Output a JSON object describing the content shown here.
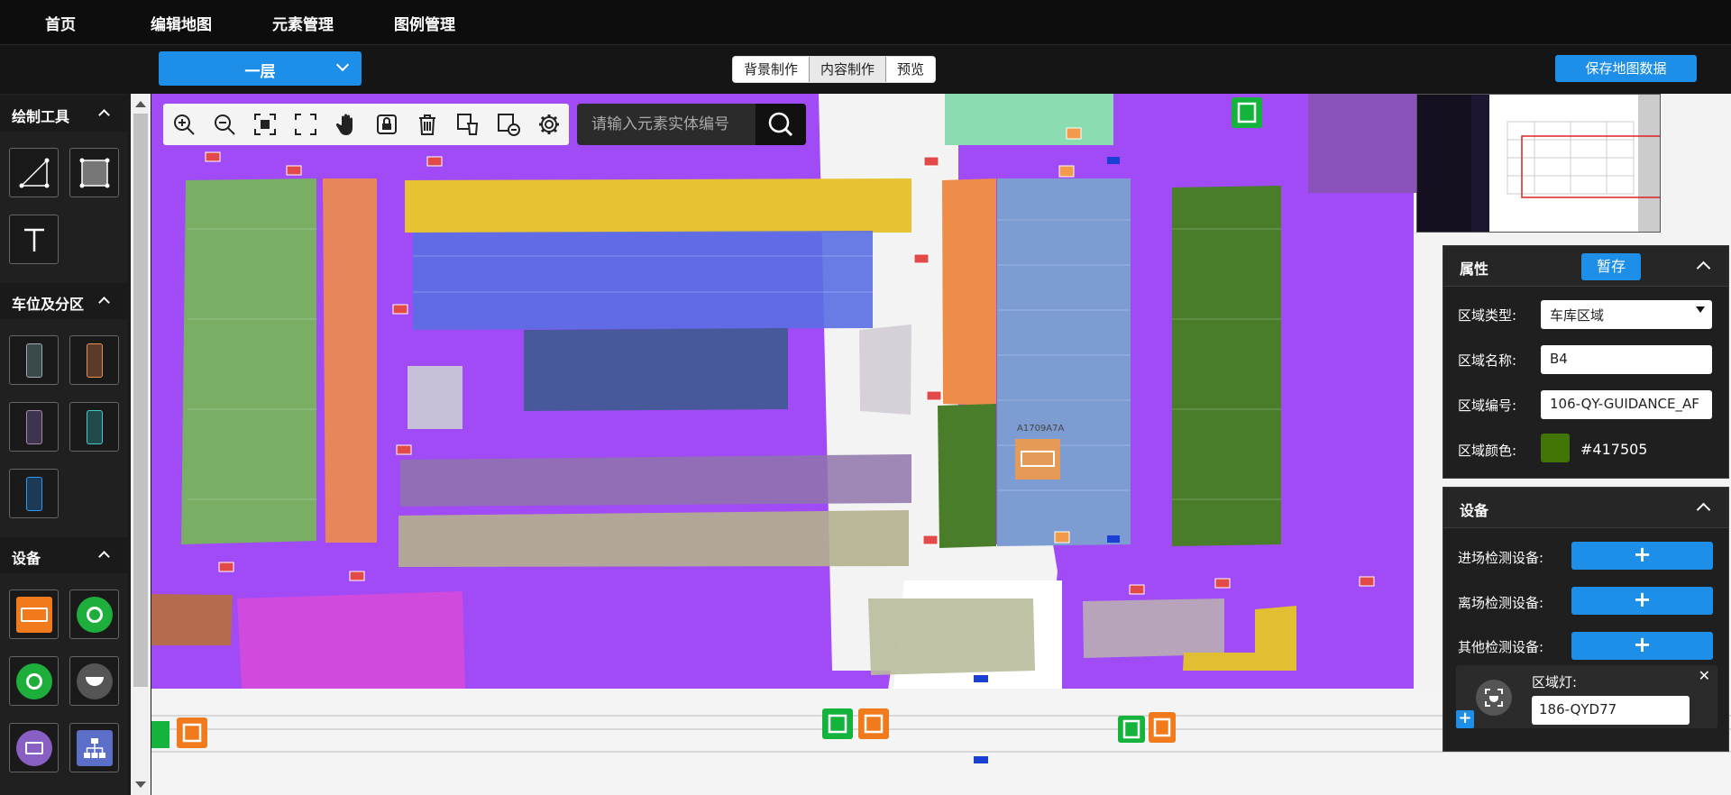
{
  "nav": {
    "home": "首页",
    "edit_map": "编辑地图",
    "element_manage": "元素管理",
    "legend_manage": "图例管理"
  },
  "floor": {
    "selected": "一层"
  },
  "modes": [
    "背景制作",
    "内容制作",
    "预览"
  ],
  "active_mode": "内容制作",
  "save_label": "保存地图数据",
  "sidebar": {
    "drawing_tools": "绘制工具",
    "parking_zones": "车位及分区",
    "devices": "设备"
  },
  "search": {
    "placeholder": "请输入元素实体编号"
  },
  "map_labels": {
    "zone_code": "A1709A7A"
  },
  "properties": {
    "title": "属性",
    "stash_label": "暂存",
    "type_label": "区域类型:",
    "type_value": "车库区域",
    "name_label": "区域名称:",
    "name_value": "B4",
    "code_label": "区域编号:",
    "code_value": "106-QY-GUIDANCE_AF",
    "color_label": "区域颜色:",
    "color_value": "#417505"
  },
  "device_panel": {
    "title": "设备",
    "entry_label": "进场检测设备:",
    "exit_label": "离场检测设备:",
    "other_label": "其他检测设备:",
    "add_symbol": "+",
    "zone_light_label": "区域灯:",
    "zone_light_value": "186-QYD77",
    "close_symbol": "✕"
  },
  "colors": {
    "accent": "#1e8fe8",
    "zone_purple": "#a04bf5",
    "zone_color": "#417505"
  }
}
